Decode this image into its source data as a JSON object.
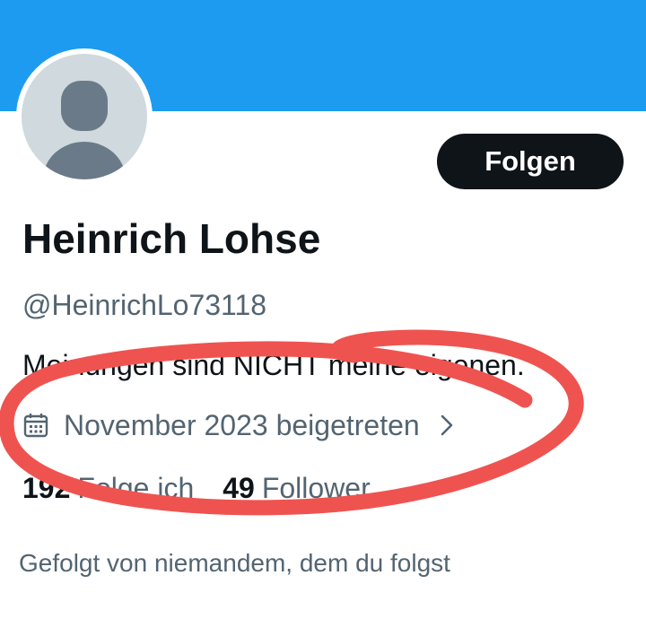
{
  "profile": {
    "display_name": "Heinrich Lohse",
    "handle": "@HeinrichLo73118",
    "bio": "Meinungen sind NICHT meine eigenen.",
    "joined": "November 2023 beigetreten",
    "following_count": "192",
    "following_label": "Folge ich",
    "followers_count": "49",
    "followers_label": "Follower",
    "followed_by": "Gefolgt von niemandem, dem du folgst"
  },
  "actions": {
    "follow_label": "Folgen"
  },
  "colors": {
    "banner": "#1d9bf0",
    "primary_text": "#0f1419",
    "secondary_text": "#536471",
    "avatar_bg": "#cfd9de",
    "avatar_silhouette": "#6b7a88",
    "button_bg": "#0f1419",
    "annotation": "#ef5350"
  },
  "icons": {
    "joined": "calendar-icon",
    "joined_more": "chevron-right-icon",
    "avatar": "default-avatar-silhouette"
  }
}
